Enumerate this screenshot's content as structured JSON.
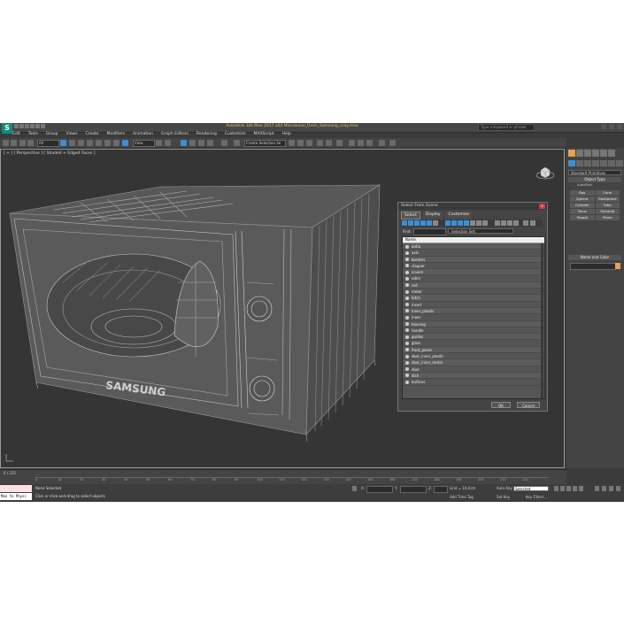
{
  "app": {
    "title": "Autodesk 3ds Max 2017 x64   Microwave_Oven_Samsung_vray.max",
    "search_placeholder": "Type a keyword or phrase",
    "menu": [
      "Edit",
      "Tools",
      "Group",
      "Views",
      "Create",
      "Modifiers",
      "Animation",
      "Graph Editors",
      "Rendering",
      "Customize",
      "MAXScript",
      "Help"
    ]
  },
  "toolbar": {
    "filter": "All",
    "view": "View",
    "selection_set": "Create Selection Se"
  },
  "viewport": {
    "label": "[ + ] [ Perspective ] [ Shaded + Edged Faces ]",
    "model_brand": "SAMSUNG"
  },
  "command_panel": {
    "dropdown": "Standard Primitives",
    "object_type_header": "Object Type",
    "autogrid": "AutoGrid",
    "buttons": [
      "Box",
      "Cone",
      "Sphere",
      "GeoSphere",
      "Cylinder",
      "Tube",
      "Torus",
      "Pyramid",
      "Teapot",
      "Plane"
    ],
    "name_color_header": "Name and Color"
  },
  "dialog": {
    "title": "Select From Scene",
    "close": "x",
    "menu": [
      "Select",
      "Display",
      "Customize"
    ],
    "find_label": "Find:",
    "selection_set": "Selection Set:",
    "column_header": "Name",
    "items": [
      "antia",
      "axis",
      "borders",
      "clapper",
      "covers",
      "roller",
      "rod",
      "metal",
      "latch",
      "insert",
      "inner_plastic",
      "inner",
      "housing",
      "handle",
      "guides",
      "glass",
      "front_panel",
      "door_inner_plastic",
      "door_inner_metal",
      "door",
      "dish",
      "buttons"
    ],
    "ok": "OK",
    "cancel": "Cancel"
  },
  "timeline": {
    "frame": "0 / 225",
    "ticks": [
      "0",
      "10",
      "20",
      "30",
      "40",
      "50",
      "60",
      "70",
      "80",
      "90",
      "100",
      "110",
      "120",
      "130",
      "140",
      "150",
      "160",
      "170",
      "180",
      "190",
      "200",
      "210",
      "220"
    ]
  },
  "status": {
    "maxscript": "Max to Physc",
    "selected": "None Selected",
    "hint": "Click or click-and-drag to select objects",
    "x_label": "X:",
    "y_label": "Y:",
    "z_label": "Z:",
    "grid": "Grid = 10,0cm",
    "add_time_tag": "Add Time Tag",
    "auto_key": "Auto Key",
    "set_key": "Set Key",
    "selected_dd": "Selected",
    "key_filters": "Key Filters..."
  }
}
